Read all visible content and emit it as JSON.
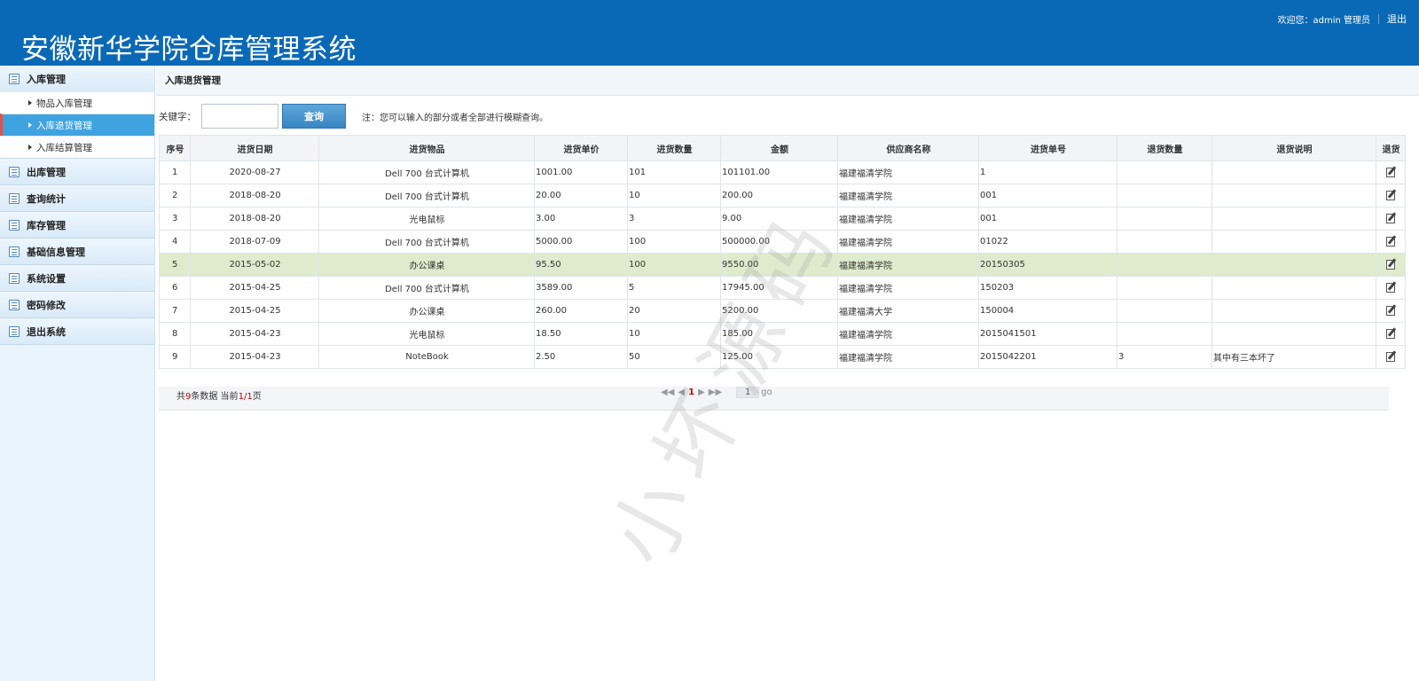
{
  "header": {
    "title": "安徽新华学院仓库管理系统",
    "welcome": "欢迎您：admin 管理员",
    "logout": "退出"
  },
  "sidebar": {
    "groups": [
      {
        "label": "入库管理",
        "items": [
          "物品入库管理",
          "入库退货管理",
          "入库结算管理"
        ],
        "active": "入库退货管理"
      },
      {
        "label": "出库管理"
      },
      {
        "label": "查询统计"
      },
      {
        "label": "库存管理"
      },
      {
        "label": "基础信息管理"
      },
      {
        "label": "系统设置"
      },
      {
        "label": "密码修改"
      },
      {
        "label": "退出系统"
      }
    ]
  },
  "breadcrumb": "入库退货管理",
  "search": {
    "label": "关键字：",
    "value": "",
    "button": "查询",
    "note": "注：您可以输入的部分或者全部进行模糊查询。"
  },
  "table": {
    "columns": [
      "序号",
      "进货日期",
      "进货物品",
      "进货单价",
      "进货数量",
      "金额",
      "供应商名称",
      "进货单号",
      "退货数量",
      "退货说明",
      "退货"
    ],
    "rows": [
      [
        "1",
        "2020-08-27",
        "Dell 700 台式计算机",
        "1001.00",
        "101",
        "101101.00",
        "福建福清学院",
        "1",
        "",
        ""
      ],
      [
        "2",
        "2018-08-20",
        "Dell 700 台式计算机",
        "20.00",
        "10",
        "200.00",
        "福建福清学院",
        "001",
        "",
        ""
      ],
      [
        "3",
        "2018-08-20",
        "光电鼠标",
        "3.00",
        "3",
        "9.00",
        "福建福清学院",
        "001",
        "",
        ""
      ],
      [
        "4",
        "2018-07-09",
        "Dell 700 台式计算机",
        "5000.00",
        "100",
        "500000.00",
        "福建福清学院",
        "01022",
        "",
        ""
      ],
      [
        "5",
        "2015-05-02",
        "办公课桌",
        "95.50",
        "100",
        "9550.00",
        "福建福清学院",
        "20150305",
        "",
        ""
      ],
      [
        "6",
        "2015-04-25",
        "Dell 700 台式计算机",
        "3589.00",
        "5",
        "17945.00",
        "福建福清学院",
        "150203",
        "",
        ""
      ],
      [
        "7",
        "2015-04-25",
        "办公课桌",
        "260.00",
        "20",
        "5200.00",
        "福建福清大学",
        "150004",
        "",
        ""
      ],
      [
        "8",
        "2015-04-23",
        "光电鼠标",
        "18.50",
        "10",
        "185.00",
        "福建福清学院",
        "2015041501",
        "",
        ""
      ],
      [
        "9",
        "2015-04-23",
        "NoteBook",
        "2.50",
        "50",
        "125.00",
        "福建福清学院",
        "2015042201",
        "3",
        "其中有三本坏了"
      ]
    ],
    "highlighted_row": 5,
    "action_icon": "edit-icon"
  },
  "pager": {
    "prefix": "共",
    "total": "9",
    "mid": "条数据 当前",
    "current": "1",
    "slash": "/",
    "pages": "1",
    "suffix": "页",
    "first": "◀◀",
    "prev": "◀",
    "page_link": "1",
    "next": "▶",
    "last": "▶▶",
    "page_input": "1",
    "go": "go"
  },
  "watermark": "小坏源码",
  "colors": {
    "header_bg": "#0a69b6",
    "active_item_bg": "#3fa3e0",
    "search_button": "#3785c4",
    "highlight_row": "#dfebcd"
  }
}
